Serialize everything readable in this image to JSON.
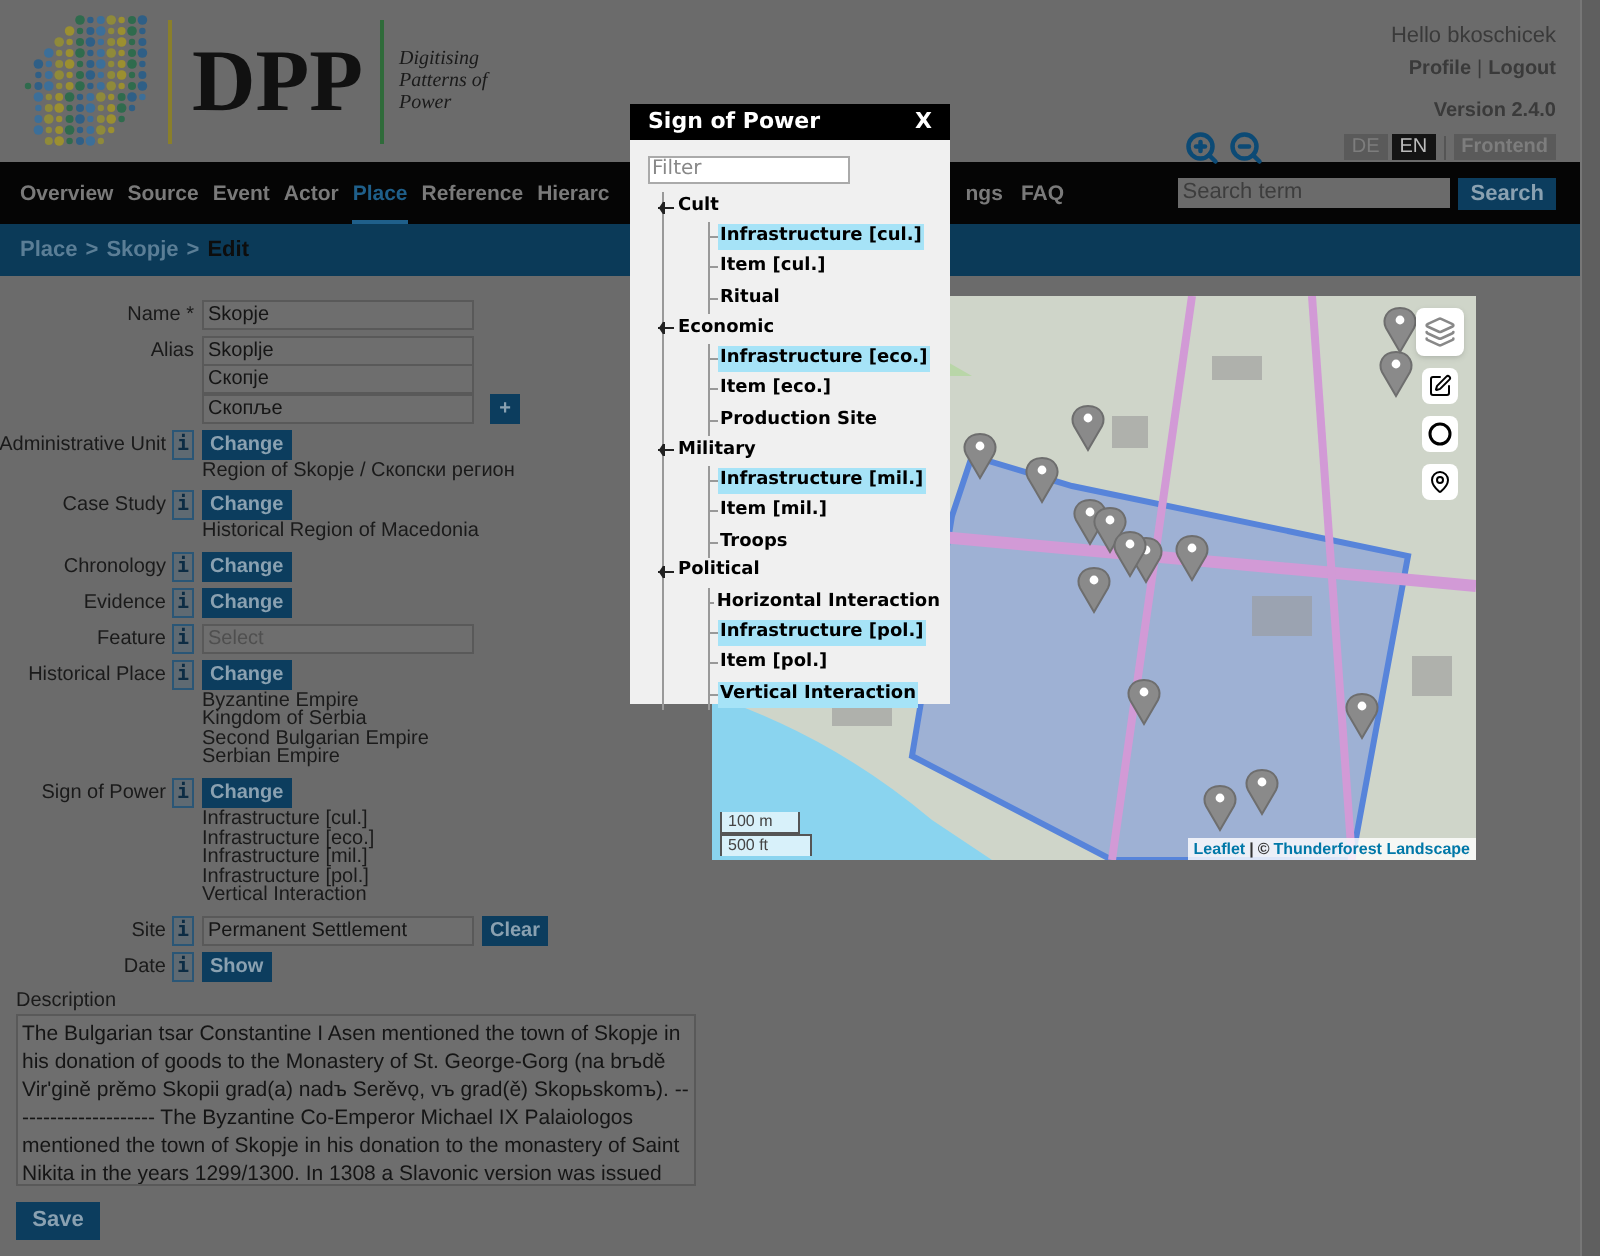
{
  "header": {
    "logo": {
      "abbr": "DPP",
      "tagline": [
        "Digitising",
        "Patterns of",
        "Power"
      ]
    },
    "greeting": "Hello bkoschicek",
    "user_links": [
      {
        "label": "Profile"
      },
      {
        "label": "Logout"
      }
    ],
    "link_separator": "|",
    "version": "Version 2.4.0",
    "languages": [
      {
        "label": "DE",
        "selected": false
      },
      {
        "label": "EN",
        "selected": true
      }
    ],
    "frontend": "Frontend"
  },
  "nav": {
    "items": [
      {
        "label": "Overview",
        "selected": false
      },
      {
        "label": "Source",
        "selected": false
      },
      {
        "label": "Event",
        "selected": false
      },
      {
        "label": "Actor",
        "selected": false
      },
      {
        "label": "Place",
        "selected": true
      },
      {
        "label": "Reference",
        "selected": false
      },
      {
        "label": "Hierarc",
        "selected": false
      }
    ],
    "items_after_dialog": [
      {
        "label": "ngs",
        "selected": false
      },
      {
        "label": "FAQ",
        "selected": false
      }
    ],
    "search": {
      "placeholder": "Search term",
      "button": "Search"
    }
  },
  "breadcrumb": [
    {
      "label": "Place",
      "kind": "link"
    },
    {
      "label": ">",
      "kind": "separator"
    },
    {
      "label": "Skopje",
      "kind": "link"
    },
    {
      "label": ">",
      "kind": "separator"
    },
    {
      "label": "Edit",
      "kind": "current"
    }
  ],
  "form": [
    {
      "kind": "input",
      "label": "Name *",
      "value": "Skopje"
    },
    {
      "kind": "aliases",
      "label": "Alias",
      "values": [
        "Skoplje",
        "Скопје",
        "Скопље"
      ],
      "add": "+"
    },
    {
      "kind": "change",
      "label": "Administrative Unit",
      "info": "i",
      "button": "Change",
      "values": [
        "Region of Skopje / Скопски регион"
      ]
    },
    {
      "kind": "change",
      "label": "Case Study",
      "info": "i",
      "button": "Change",
      "values": [
        "Historical Region of Macedonia"
      ]
    },
    {
      "kind": "change",
      "label": "Chronology",
      "info": "i",
      "button": "Change"
    },
    {
      "kind": "change",
      "label": "Evidence",
      "info": "i",
      "button": "Change"
    },
    {
      "kind": "select",
      "label": "Feature",
      "info": "i",
      "placeholder": "Select"
    },
    {
      "kind": "change",
      "label": "Historical Place",
      "info": "i",
      "button": "Change",
      "values": [
        "Byzantine Empire",
        "Kingdom of Serbia",
        "Second Bulgarian Empire",
        "Serbian Empire"
      ]
    },
    {
      "kind": "change",
      "label": "Sign of Power",
      "info": "i",
      "button": "Change",
      "values": [
        "Infrastructure [cul.]",
        "Infrastructure [eco.]",
        "Infrastructure [mil.]",
        "Infrastructure [pol.]",
        "Vertical Interaction"
      ]
    },
    {
      "kind": "input_button",
      "label": "Site",
      "info": "i",
      "value": "Permanent Settlement",
      "button": "Clear"
    },
    {
      "kind": "change",
      "label": "Date",
      "info": "i",
      "button": "Show"
    }
  ],
  "map": {
    "scale": [
      "100 m",
      "500 ft"
    ],
    "attribution": {
      "library": "Leaflet",
      "separator": "|",
      "copyright": "©",
      "provider": "Thunderforest Landscape"
    }
  },
  "description": {
    "label": "Description",
    "value": "The Bulgarian tsar Constantine I Asen mentioned the town of Skopje in his donation of goods to the Monastery of St. George-Gorg (na brъdě Vir'gině prěmo Skopii grad(a) nadъ Serěvǫ, vъ grad(ě) Skopьskomъ). --------------------- The Byzantine Co-Emperor Michael IX Palaiologos mentioned the town of Skopje in his donation to the monastery of Saint Nikita in the years 1299/1300. In 1308 a Slavonic version was issued"
  },
  "save": "Save",
  "dialog": {
    "title": "Sign of Power",
    "close": "X",
    "filter_placeholder": "Filter",
    "tree": [
      {
        "label": "Cult",
        "expanded": true,
        "children": [
          {
            "label": "Infrastructure [cul.]",
            "selected": true
          },
          {
            "label": "Item [cul.]",
            "selected": false
          },
          {
            "label": "Ritual",
            "selected": false
          }
        ]
      },
      {
        "label": "Economic",
        "expanded": true,
        "children": [
          {
            "label": "Infrastructure [eco.]",
            "selected": true
          },
          {
            "label": "Item [eco.]",
            "selected": false
          },
          {
            "label": "Production Site",
            "selected": false
          }
        ]
      },
      {
        "label": "Military",
        "expanded": true,
        "children": [
          {
            "label": "Infrastructure [mil.]",
            "selected": true
          },
          {
            "label": "Item [mil.]",
            "selected": false
          },
          {
            "label": "Troops",
            "selected": false
          }
        ]
      },
      {
        "label": "Political",
        "expanded": true,
        "children": [
          {
            "label": "Horizontal Interaction",
            "selected": false
          },
          {
            "label": "Infrastructure [pol.]",
            "selected": true
          },
          {
            "label": "Item [pol.]",
            "selected": false
          },
          {
            "label": "Vertical Interaction",
            "selected": true
          }
        ]
      }
    ]
  }
}
